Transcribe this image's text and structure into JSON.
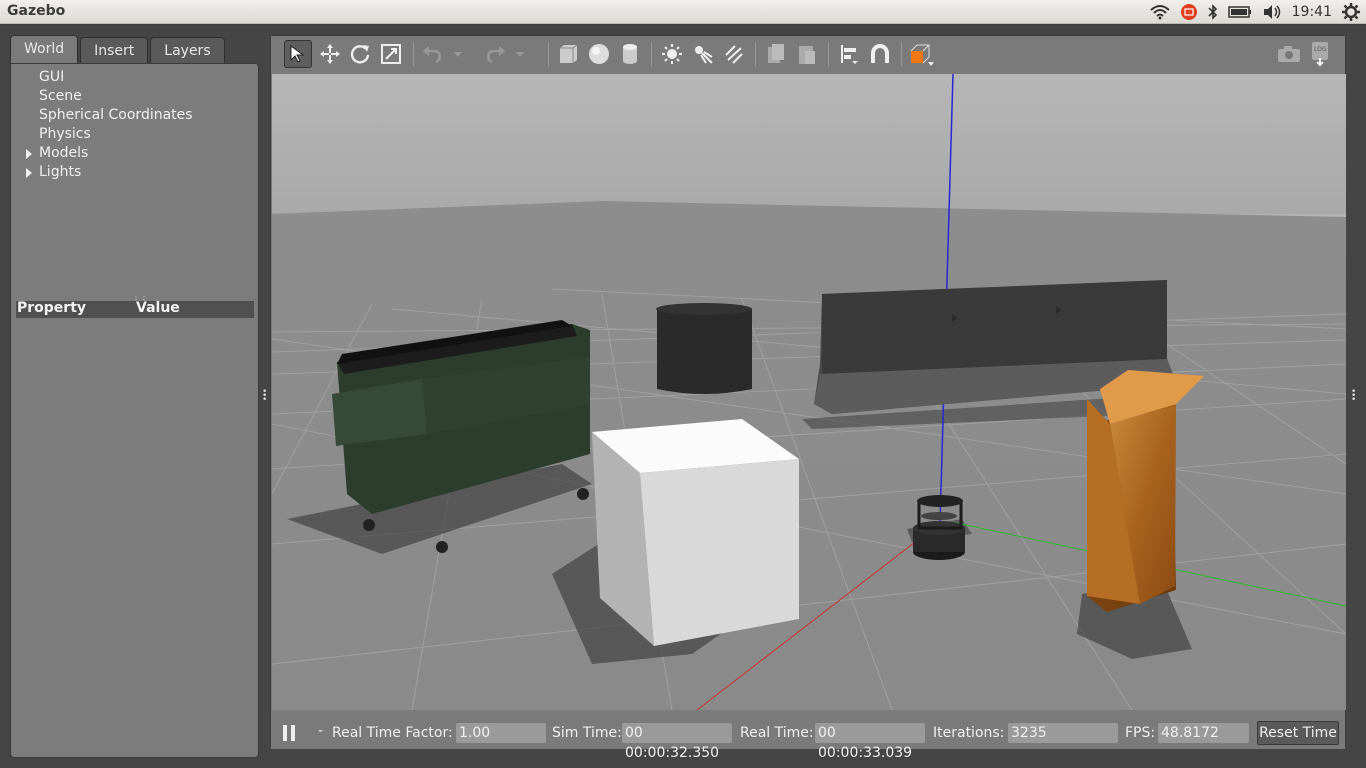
{
  "window_title": "Gazebo",
  "clock": "19:41",
  "tray_icons": [
    "wifi-icon",
    "keyboard-indicator-icon",
    "bluetooth-icon",
    "battery-icon",
    "volume-icon",
    "settings-gear-icon"
  ],
  "left_panel": {
    "tabs": [
      {
        "label": "World",
        "active": true
      },
      {
        "label": "Insert",
        "active": false
      },
      {
        "label": "Layers",
        "active": false
      }
    ],
    "tree": [
      {
        "label": "GUI",
        "expandable": false
      },
      {
        "label": "Scene",
        "expandable": false
      },
      {
        "label": "Spherical Coordinates",
        "expandable": false
      },
      {
        "label": "Physics",
        "expandable": false
      },
      {
        "label": "Models",
        "expandable": true
      },
      {
        "label": "Lights",
        "expandable": true
      }
    ],
    "property_header": {
      "property": "Property",
      "value": "Value"
    }
  },
  "toolbar": {
    "tools": [
      "select-arrow-icon",
      "translate-icon",
      "rotate-icon",
      "scale-icon",
      "undo-icon",
      "redo-icon",
      "box-shape-icon",
      "sphere-shape-icon",
      "cylinder-shape-icon",
      "point-light-icon",
      "spot-light-icon",
      "directional-light-icon",
      "copy-icon",
      "paste-icon",
      "align-icon",
      "snap-magnet-icon",
      "view-angle-icon",
      "screenshot-camera-icon",
      "log-icon"
    ]
  },
  "status": {
    "real_time_factor_label": "Real Time Factor:",
    "real_time_factor": "1.00",
    "sim_time_label": "Sim Time:",
    "sim_time": "00 00:00:32.350",
    "real_time_label": "Real Time:",
    "real_time": "00 00:00:33.039",
    "iterations_label": "Iterations:",
    "iterations": "3235",
    "fps_label": "FPS:",
    "fps": "48.8172",
    "reset_time_label": "Reset Time",
    "step_hint": "-"
  },
  "colors": {
    "viewport_sky": "#b3b3b3",
    "ground": "#8e8e8e",
    "x_axis": "#c83232",
    "y_axis": "#32b432",
    "z_axis": "#2828d2",
    "cabinet_wood": "#b8701e",
    "dumpster": "#2c3d2e",
    "barrier": "#474747",
    "box": "#e6e6e6"
  }
}
